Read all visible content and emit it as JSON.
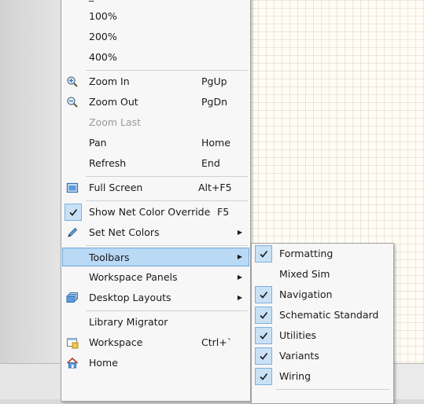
{
  "main_menu": {
    "zoom_presets": [
      "100%",
      "200%",
      "400%"
    ],
    "zoom_in": {
      "label": "Zoom In",
      "shortcut": "PgUp"
    },
    "zoom_out": {
      "label": "Zoom Out",
      "shortcut": "PgDn"
    },
    "zoom_last": {
      "label": "Zoom Last"
    },
    "pan": {
      "label": "Pan",
      "shortcut": "Home"
    },
    "refresh": {
      "label": "Refresh",
      "shortcut": "End"
    },
    "full_screen": {
      "label": "Full Screen",
      "shortcut": "Alt+F5"
    },
    "show_net_color_override": {
      "label": "Show Net Color Override",
      "shortcut": "F5"
    },
    "set_net_colors": {
      "label": "Set Net Colors"
    },
    "toolbars": {
      "label": "Toolbars"
    },
    "workspace_panels": {
      "label": "Workspace Panels"
    },
    "desktop_layouts": {
      "label": "Desktop Layouts"
    },
    "library_migrator": {
      "label": "Library Migrator"
    },
    "workspace": {
      "label": "Workspace",
      "shortcut": "Ctrl+`"
    },
    "home": {
      "label": "Home"
    }
  },
  "toolbars_submenu": {
    "items": [
      {
        "label": "Formatting",
        "checked": true
      },
      {
        "label": "Mixed Sim",
        "checked": false
      },
      {
        "label": "Navigation",
        "checked": true
      },
      {
        "label": "Schematic Standard",
        "checked": true
      },
      {
        "label": "Utilities",
        "checked": true
      },
      {
        "label": "Variants",
        "checked": true
      },
      {
        "label": "Wiring",
        "checked": true
      }
    ]
  },
  "colors": {
    "highlight": "#b9d9f5",
    "check_bg": "#c9e1f6",
    "menu_bg": "#f7f7f7"
  },
  "icons": [
    "zoom-in-icon",
    "zoom-out-icon",
    "full-screen-icon",
    "check-icon",
    "pencil-icon",
    "desktop-layouts-icon",
    "workspace-icon",
    "home-icon",
    "submenu-arrow-icon"
  ]
}
